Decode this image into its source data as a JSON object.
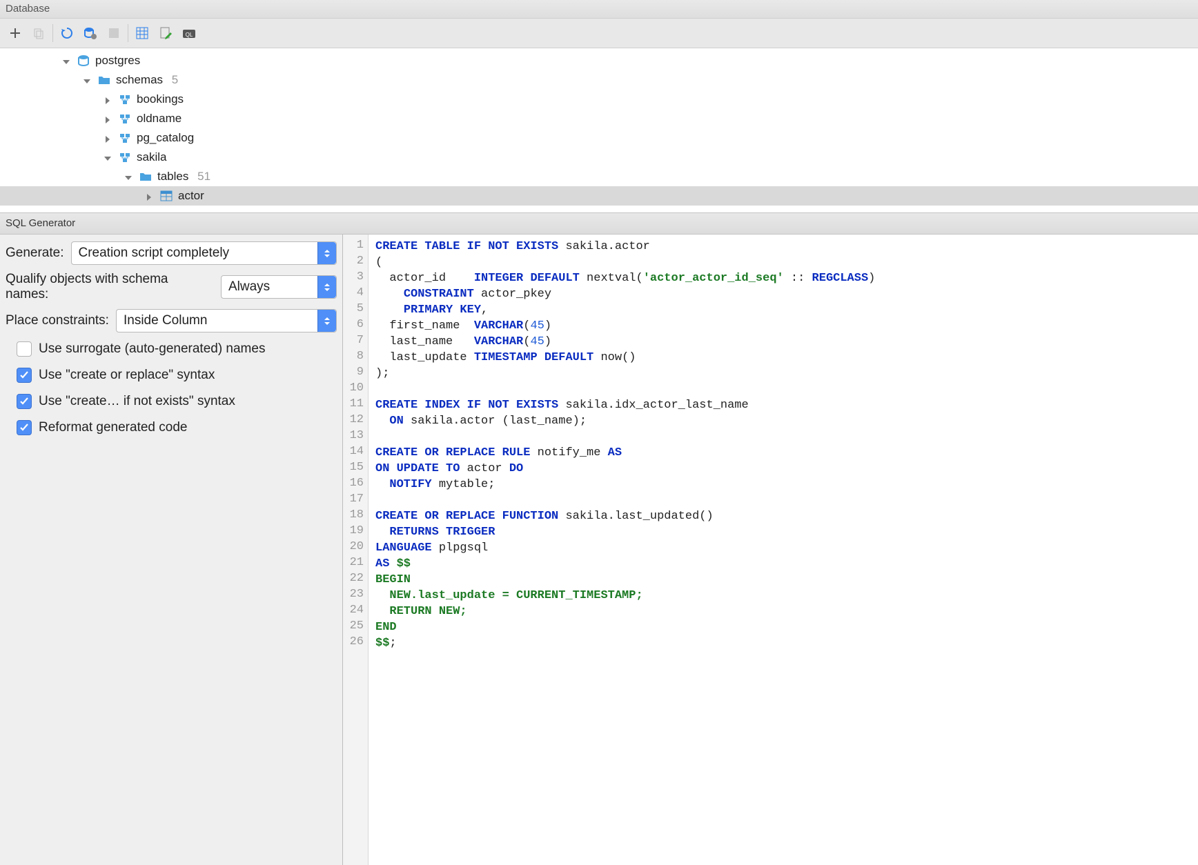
{
  "panel": {
    "title": "Database"
  },
  "tree": {
    "postgres": "postgres",
    "schemas_label": "schemas",
    "schemas_count": "5",
    "schema": {
      "bookings": "bookings",
      "oldname": "oldname",
      "pg_catalog": "pg_catalog",
      "sakila": "sakila"
    },
    "tables_label": "tables",
    "tables_count": "51",
    "table_actor": "actor"
  },
  "sqlgen": {
    "title": "SQL Generator",
    "generate_label": "Generate:",
    "generate_value": "Creation script completely",
    "qualify_label": "Qualify objects with schema names:",
    "qualify_value": "Always",
    "constraints_label": "Place constraints:",
    "constraints_value": "Inside Column",
    "chk_surrogate": "Use surrogate (auto-generated) names",
    "chk_create_replace": "Use \"create or replace\" syntax",
    "chk_if_not_exists": "Use \"create… if not exists\" syntax",
    "chk_reformat": "Reformat generated code"
  }
}
